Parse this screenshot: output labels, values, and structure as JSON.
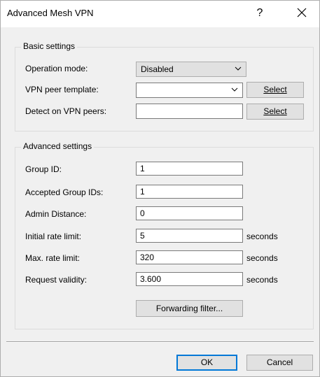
{
  "window": {
    "title": "Advanced Mesh VPN",
    "help_label": "?",
    "close_label": "✕"
  },
  "basic": {
    "title": "Basic settings",
    "operation_mode": {
      "label": "Operation mode:",
      "value": "Disabled"
    },
    "vpn_peer_template": {
      "label": "VPN peer template:",
      "value": "",
      "select_label": "Select"
    },
    "detect_on_vpn_peers": {
      "label": "Detect on VPN peers:",
      "value": "",
      "select_label": "Select"
    }
  },
  "advanced": {
    "title": "Advanced settings",
    "group_id": {
      "label": "Group ID:",
      "value": "1"
    },
    "accepted_group_ids": {
      "label": "Accepted Group IDs:",
      "value": "1"
    },
    "admin_distance": {
      "label": "Admin Distance:",
      "value": "0"
    },
    "initial_rate_limit": {
      "label": "Initial rate limit:",
      "value": "5",
      "unit": "seconds"
    },
    "max_rate_limit": {
      "label": "Max. rate limit:",
      "value": "320",
      "unit": "seconds"
    },
    "request_validity": {
      "label": "Request validity:",
      "value": "3.600",
      "unit": "seconds"
    },
    "forwarding_filter_label": "Forwarding filter..."
  },
  "footer": {
    "ok_label": "OK",
    "cancel_label": "Cancel"
  },
  "icons": {
    "chevron": "chevron-down-icon",
    "help": "help-icon",
    "close": "close-icon"
  }
}
